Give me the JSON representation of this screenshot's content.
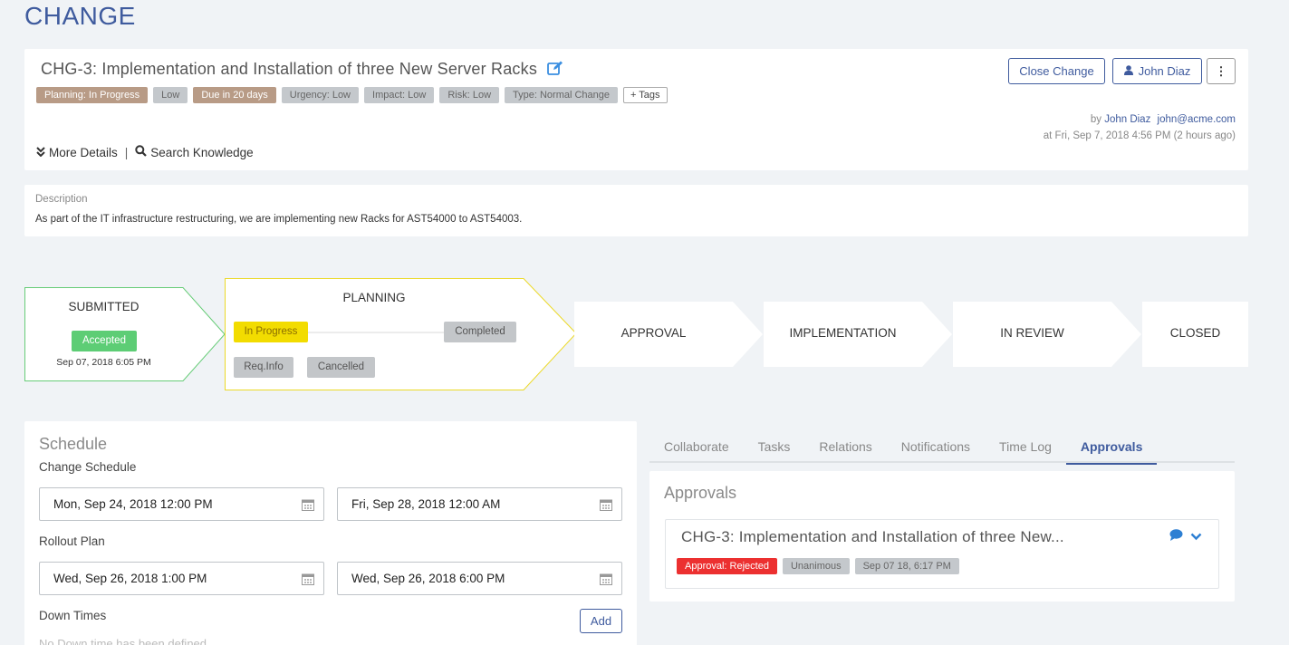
{
  "page": {
    "title": "CHANGE"
  },
  "ticket": {
    "title": "CHG-3: Implementation and Installation of three New Server Racks",
    "badges": [
      {
        "label": "Planning: In Progress",
        "style": "brown"
      },
      {
        "label": "Low",
        "style": "grey"
      },
      {
        "label": "Due in 20 days",
        "style": "brown"
      },
      {
        "label": "Urgency: Low",
        "style": "grey"
      },
      {
        "label": "Impact: Low",
        "style": "grey"
      },
      {
        "label": "Risk: Low",
        "style": "grey"
      },
      {
        "label": "Type: Normal Change",
        "style": "grey"
      }
    ],
    "tags_button": "+ Tags",
    "close_button": "Close Change",
    "owner_button": "John Diaz",
    "kebab": "⋮",
    "meta_by": "by",
    "meta_user": "John Diaz",
    "meta_email": "john@acme.com",
    "meta_time": "at Fri, Sep 7, 2018 4:56 PM (2 hours ago)",
    "more_details": "More Details",
    "search_knowledge": "Search Knowledge"
  },
  "description": {
    "label": "Description",
    "text": "As part of the IT infrastructure restructuring, we are implementing new Racks for AST54000 to AST54003."
  },
  "workflow": {
    "submitted": {
      "label": "SUBMITTED",
      "status": "Accepted",
      "date": "Sep 07, 2018 6:05 PM"
    },
    "planning": {
      "label": "PLANNING",
      "in_progress": "In Progress",
      "completed": "Completed",
      "req_info": "Req.Info",
      "cancelled": "Cancelled"
    },
    "stages": [
      "APPROVAL",
      "IMPLEMENTATION",
      "IN REVIEW",
      "CLOSED"
    ]
  },
  "schedule": {
    "title": "Schedule",
    "change_label": "Change Schedule",
    "change_start": "Mon, Sep 24, 2018 12:00 PM",
    "change_end": "Fri, Sep 28, 2018 12:00 AM",
    "rollout_label": "Rollout Plan",
    "rollout_start": "Wed, Sep 26, 2018 1:00 PM",
    "rollout_end": "Wed, Sep 26, 2018 6:00 PM",
    "downtimes_label": "Down Times",
    "add_button": "Add",
    "downtimes_empty": "No Down time has been defined"
  },
  "tabs": {
    "items": [
      "Collaborate",
      "Tasks",
      "Relations",
      "Notifications",
      "Time Log",
      "Approvals"
    ],
    "active": "Approvals"
  },
  "approvals": {
    "title": "Approvals",
    "item_title": "CHG-3: Implementation and Installation of three New...",
    "status": "Approval: Rejected",
    "type": "Unanimous",
    "date": "Sep 07 18, 6:17 PM"
  },
  "colors": {
    "accent": "#3f5b9e",
    "green": "#5dcd75",
    "yellow": "#f2dc00",
    "red": "#ec3030",
    "brown": "#b89b86"
  }
}
